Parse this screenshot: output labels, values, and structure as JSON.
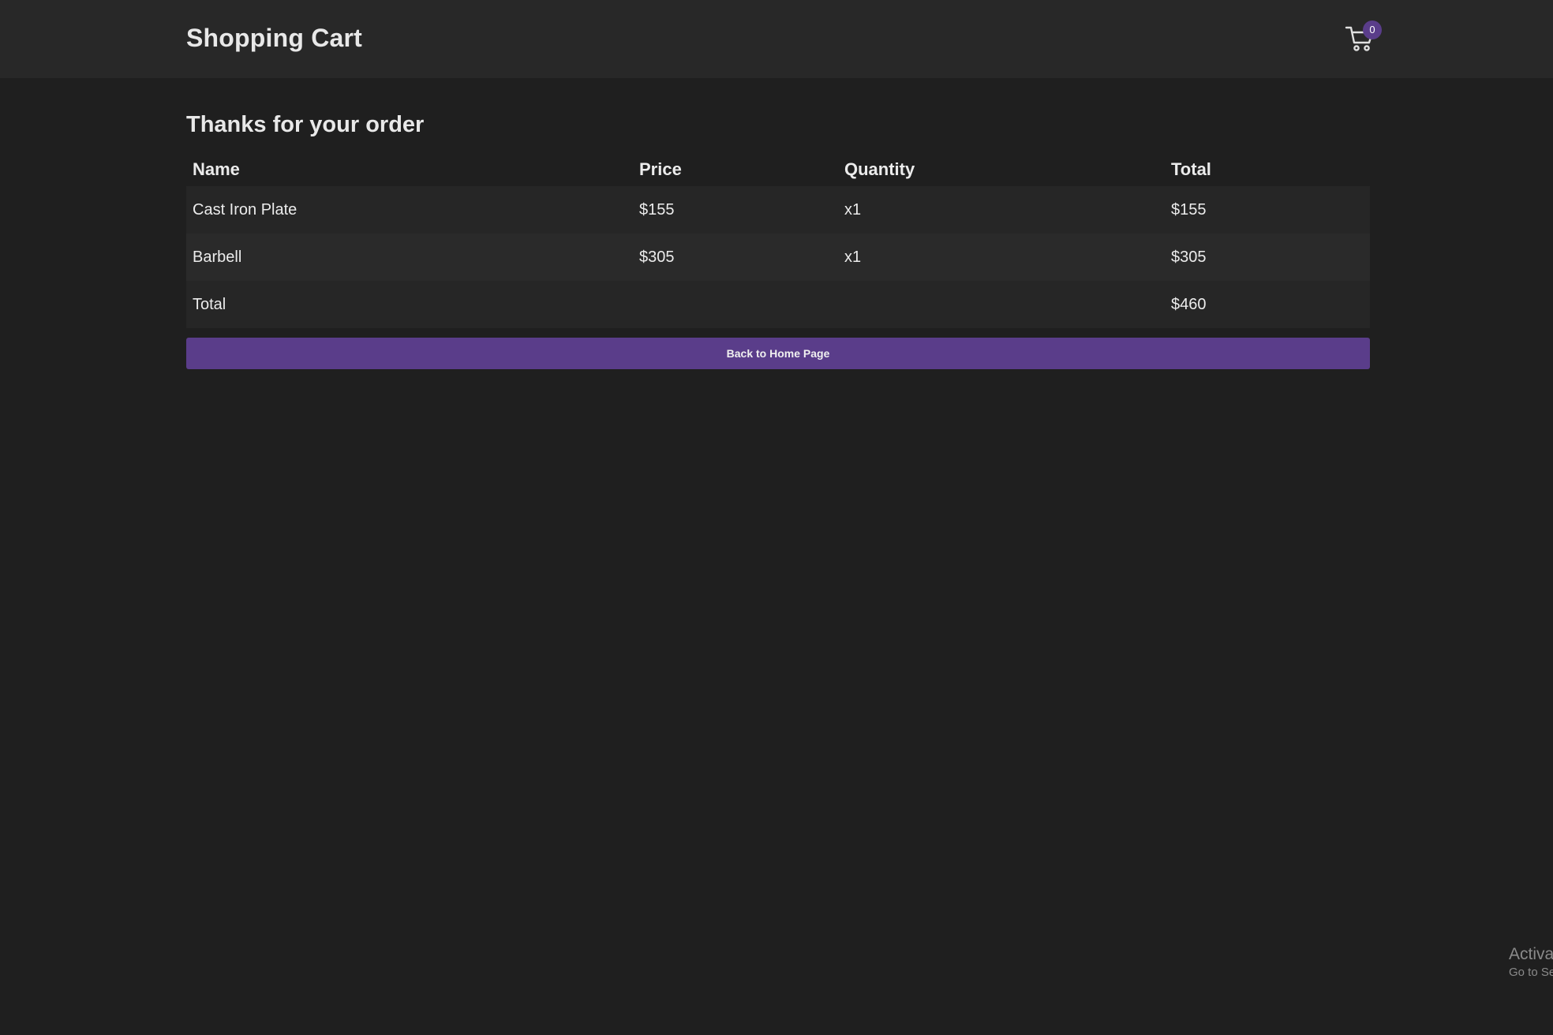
{
  "header": {
    "title": "Shopping Cart",
    "cart_count": "0"
  },
  "main": {
    "heading": "Thanks for your order",
    "table": {
      "columns": [
        "Name",
        "Price",
        "Quantity",
        "Total"
      ],
      "rows": [
        {
          "name": "Cast Iron Plate",
          "price": "$155",
          "quantity": "x1",
          "total": "$155"
        },
        {
          "name": "Barbell",
          "price": "$305",
          "quantity": "x1",
          "total": "$305"
        }
      ],
      "summary": {
        "label": "Total",
        "value": "$460"
      }
    },
    "back_button_label": "Back to Home Page"
  },
  "watermark": {
    "line1": "Activa",
    "line2": "Go to Se"
  },
  "colors": {
    "background": "#1f1f1f",
    "header_bg": "#282828",
    "accent": "#5a3d8a"
  },
  "icons": {
    "cart": "shopping-cart-icon"
  }
}
